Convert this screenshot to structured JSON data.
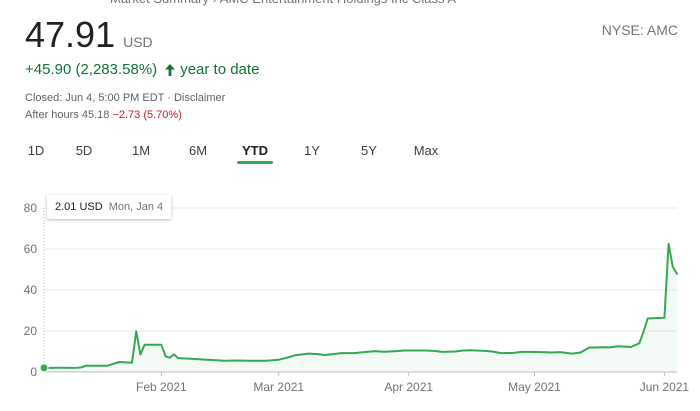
{
  "header": {
    "price": "47.91",
    "currency": "USD",
    "exchange": "NYSE: AMC",
    "change": "+45.90 (2,283.58%)",
    "change_period": "year to date",
    "closed_info": "Closed: Jun 4, 5:00 PM EDT · Disclaimer",
    "after_hours_label": "After hours 45.18",
    "after_hours_change": "−2.73 (5.70%)"
  },
  "tabs": [
    {
      "label": "1D"
    },
    {
      "label": "5D"
    },
    {
      "label": "1M"
    },
    {
      "label": "6M"
    },
    {
      "label": "YTD",
      "active": true
    },
    {
      "label": "1Y"
    },
    {
      "label": "5Y"
    },
    {
      "label": "Max"
    }
  ],
  "tooltip": {
    "value": "2.01 USD",
    "date": "Mon, Jan 4"
  },
  "colors": {
    "line": "#34a853",
    "grid": "#e8eaed",
    "axis": "#bdc1c6"
  },
  "icons": {
    "change_arrow": "arrow-up-icon"
  },
  "chart_data": {
    "type": "line",
    "title": "",
    "xlabel": "",
    "ylabel": "",
    "ylim": [
      0,
      80
    ],
    "yticks": [
      0,
      20,
      40,
      60,
      80
    ],
    "x_range": [
      "2021-01-04",
      "2021-06-04"
    ],
    "xticks": [
      {
        "date": "2021-02-01",
        "label": "Feb 2021"
      },
      {
        "date": "2021-03-01",
        "label": "Mar 2021"
      },
      {
        "date": "2021-04-01",
        "label": "Apr 2021"
      },
      {
        "date": "2021-05-01",
        "label": "May 2021"
      },
      {
        "date": "2021-06-01",
        "label": "Jun 2021"
      }
    ],
    "grid": true,
    "series": [
      {
        "points": [
          [
            "2021-01-04",
            2.01
          ],
          [
            "2021-01-05",
            1.98
          ],
          [
            "2021-01-06",
            2.0
          ],
          [
            "2021-01-07",
            2.05
          ],
          [
            "2021-01-08",
            2.1
          ],
          [
            "2021-01-11",
            2.0
          ],
          [
            "2021-01-12",
            2.05
          ],
          [
            "2021-01-13",
            2.3
          ],
          [
            "2021-01-14",
            3.0
          ],
          [
            "2021-01-15",
            3.0
          ],
          [
            "2021-01-19",
            3.0
          ],
          [
            "2021-01-20",
            3.6
          ],
          [
            "2021-01-21",
            4.3
          ],
          [
            "2021-01-22",
            4.9
          ],
          [
            "2021-01-25",
            4.5
          ],
          [
            "2021-01-26",
            19.9
          ],
          [
            "2021-01-27",
            8.6
          ],
          [
            "2021-01-28",
            13.3
          ],
          [
            "2021-01-29",
            13.3
          ],
          [
            "2021-02-01",
            13.3
          ],
          [
            "2021-02-02",
            7.6
          ],
          [
            "2021-02-03",
            7.0
          ],
          [
            "2021-02-04",
            8.6
          ],
          [
            "2021-02-05",
            6.8
          ],
          [
            "2021-02-08",
            6.5
          ],
          [
            "2021-02-12",
            6.0
          ],
          [
            "2021-02-16",
            5.5
          ],
          [
            "2021-02-19",
            5.6
          ],
          [
            "2021-02-22",
            5.5
          ],
          [
            "2021-02-26",
            5.5
          ],
          [
            "2021-03-01",
            6.0
          ],
          [
            "2021-03-03",
            7.0
          ],
          [
            "2021-03-05",
            8.2
          ],
          [
            "2021-03-08",
            9.0
          ],
          [
            "2021-03-10",
            8.8
          ],
          [
            "2021-03-12",
            8.3
          ],
          [
            "2021-03-16",
            9.2
          ],
          [
            "2021-03-19",
            9.2
          ],
          [
            "2021-03-22",
            9.8
          ],
          [
            "2021-03-24",
            10.2
          ],
          [
            "2021-03-26",
            9.9
          ],
          [
            "2021-03-29",
            10.2
          ],
          [
            "2021-03-31",
            10.5
          ],
          [
            "2021-04-01",
            10.5
          ],
          [
            "2021-04-05",
            10.5
          ],
          [
            "2021-04-07",
            10.3
          ],
          [
            "2021-04-09",
            9.8
          ],
          [
            "2021-04-12",
            10.0
          ],
          [
            "2021-04-14",
            10.5
          ],
          [
            "2021-04-16",
            10.6
          ],
          [
            "2021-04-19",
            10.3
          ],
          [
            "2021-04-21",
            10.0
          ],
          [
            "2021-04-23",
            9.2
          ],
          [
            "2021-04-26",
            9.3
          ],
          [
            "2021-04-28",
            9.8
          ],
          [
            "2021-04-30",
            9.8
          ],
          [
            "2021-05-03",
            9.7
          ],
          [
            "2021-05-05",
            9.5
          ],
          [
            "2021-05-07",
            9.7
          ],
          [
            "2021-05-10",
            9.0
          ],
          [
            "2021-05-12",
            9.5
          ],
          [
            "2021-05-14",
            11.9
          ],
          [
            "2021-05-17",
            12.1
          ],
          [
            "2021-05-19",
            12.0
          ],
          [
            "2021-05-21",
            12.6
          ],
          [
            "2021-05-24",
            12.2
          ],
          [
            "2021-05-26",
            14.0
          ],
          [
            "2021-05-27",
            19.6
          ],
          [
            "2021-05-28",
            26.1
          ],
          [
            "2021-06-01",
            26.5
          ],
          [
            "2021-06-02",
            62.5
          ],
          [
            "2021-06-03",
            51.3
          ],
          [
            "2021-06-04",
            47.9
          ]
        ]
      }
    ]
  }
}
